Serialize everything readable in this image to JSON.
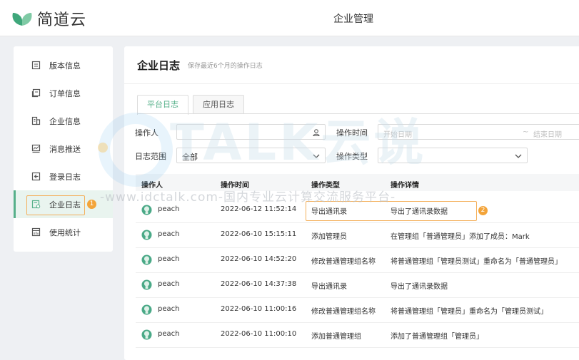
{
  "app": {
    "logo_text": "简道云",
    "title": "企业管理"
  },
  "sidebar": {
    "items": [
      {
        "label": "版本信息",
        "icon": "document-icon"
      },
      {
        "label": "订单信息",
        "icon": "order-icon"
      },
      {
        "label": "企业信息",
        "icon": "building-icon"
      },
      {
        "label": "消息推送",
        "icon": "message-icon"
      },
      {
        "label": "登录日志",
        "icon": "login-icon"
      },
      {
        "label": "企业日志",
        "icon": "log-icon",
        "active": true,
        "badge": "1"
      },
      {
        "label": "使用统计",
        "icon": "stats-icon"
      }
    ]
  },
  "main": {
    "title": "企业日志",
    "subtitle": "保存最近6个月的操作日志",
    "tabs": [
      {
        "label": "平台日志",
        "active": true
      },
      {
        "label": "应用日志"
      }
    ],
    "filters": {
      "operator_label": "操作人",
      "operator_value": "",
      "time_label": "操作时间",
      "start_placeholder": "开始日期",
      "range_sep": "~",
      "end_placeholder": "结束日期",
      "scope_label": "日志范围",
      "scope_value": "全部",
      "type_label": "操作类型",
      "type_value": ""
    },
    "table": {
      "headers": [
        "操作人",
        "操作时间",
        "操作类型",
        "操作详情"
      ],
      "rows": [
        {
          "user": "peach",
          "time": "2022-06-12 11:52:14",
          "type": "导出通讯录",
          "detail": "导出了通讯录数据",
          "highlight": true,
          "badge": "2"
        },
        {
          "user": "peach",
          "time": "2022-06-10 15:15:11",
          "type": "添加管理员",
          "detail": "在管理组「普通管理员」添加了成员：Mark"
        },
        {
          "user": "peach",
          "time": "2022-06-10 14:52:20",
          "type": "修改普通管理组名称",
          "detail": "将普通管理组「管理员测试」重命名为「普通管理员」"
        },
        {
          "user": "peach",
          "time": "2022-06-10 14:37:38",
          "type": "导出通讯录",
          "detail": "导出了通讯录数据"
        },
        {
          "user": "peach",
          "time": "2022-06-10 11:00:16",
          "type": "修改普通管理组名称",
          "detail": "将普通管理组「管理员」重命名为「管理员测试」"
        },
        {
          "user": "peach",
          "time": "2022-06-10 11:00:10",
          "type": "添加普通管理组",
          "detail": "添加了普通管理组「管理员」"
        }
      ]
    }
  },
  "watermark": {
    "brand": "TALK云说",
    "text": "-www.idctalk.com-国内专业云计算交流服务平台-"
  },
  "colors": {
    "accent": "#56b08a",
    "highlight": "#f4b05c",
    "badge": "#f3a43a"
  }
}
